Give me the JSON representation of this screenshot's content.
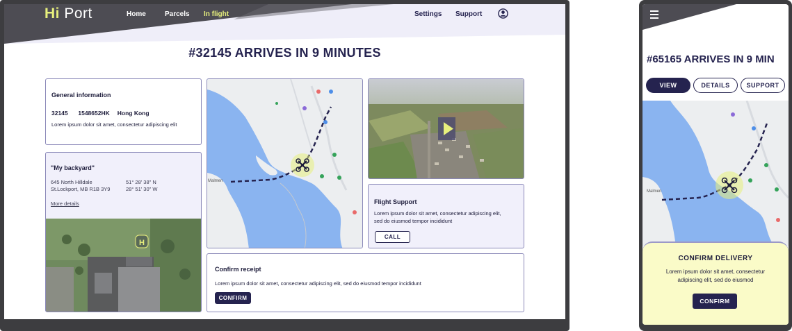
{
  "desktop": {
    "logo_hi": "Hi",
    "logo_port": "Port",
    "nav": [
      {
        "label": "Home",
        "active": false
      },
      {
        "label": "Parcels",
        "active": false
      },
      {
        "label": "In flight",
        "active": true
      }
    ],
    "nav_right": [
      "Settings",
      "Support"
    ],
    "user_icon": "user-circle-icon",
    "title": "#32145 ARRIVES IN 9 MINUTES",
    "general": {
      "title": "General information",
      "id": "32145",
      "code": "1548652HK",
      "city": "Hong Kong",
      "text": "Lorem ipsum dolor sit amet, consectetur adipiscing elit"
    },
    "destination": {
      "name": "\"My backyard\"",
      "address_line1": "645 North Hilldale",
      "address_line2": "St.Lockport, MB R1B 3Y9",
      "coord_line1": "51° 28' 38\" N",
      "coord_line2": "28° 51' 30\" W",
      "link": "More details",
      "pad_label": "H"
    },
    "map": {
      "place_label": "Malmen"
    },
    "video": {
      "play_icon": "play-icon"
    },
    "flight_support": {
      "title": "Flight Support",
      "text_line1": "Lorem ipsum dolor sit amet, consectetur adipiscing elit,",
      "text_line2": "sed do eiusmod tempor incididunt",
      "button": "CALL"
    },
    "receipt": {
      "title": "Confirm receipt",
      "text": "Lorem ipsum dolor sit amet, consectetur adipiscing elit, sed do eiusmod tempor incididunt",
      "button": "CONFIRM"
    }
  },
  "mobile": {
    "menu_icon": "hamburger-menu-icon",
    "title": "#65165 ARRIVES IN 9 MIN",
    "tabs": [
      {
        "label": "VIEW",
        "active": true
      },
      {
        "label": "DETAILS",
        "active": false
      },
      {
        "label": "SUPPORT",
        "active": false
      }
    ],
    "map": {
      "place_label": "Malmen"
    },
    "confirm": {
      "title": "CONFIRM DELIVERY",
      "text_line1": "Lorem ipsum dolor sit amet, consectetur",
      "text_line2": "adipiscing elit, sed do eiusmod",
      "button": "CONFIRM"
    }
  },
  "colors": {
    "navy": "#25234f",
    "accent_yellow": "#e7f07d",
    "water": "#8ab4f0",
    "land": "#eceef0",
    "card_tint": "#f1f0fb",
    "panel_yellow": "#fafbc8"
  }
}
